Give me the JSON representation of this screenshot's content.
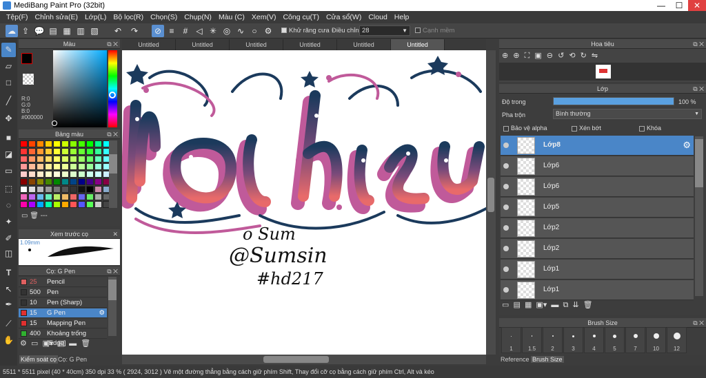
{
  "window": {
    "title": "MediBang Paint Pro (32bit)",
    "minimize": "—",
    "maximize": "☐",
    "close": "✕"
  },
  "menu": [
    "Tệp(F)",
    "Chỉnh sửa(E)",
    "Lớp(L)",
    "Bộ lọc(R)",
    "Chọn(S)",
    "Chụp(N)",
    "Màu (C)",
    "Xem(V)",
    "Công cụ(T)",
    "Cửa sổ(W)",
    "Cloud",
    "Help"
  ],
  "toolbar": {
    "antialias_label": "Khử răng cưa",
    "correction_label": "Điều chỉnh",
    "correction_value": "28",
    "sharp_label": "Cạnh mềm"
  },
  "tabs": [
    "Untitled",
    "Untitled",
    "Untitled",
    "Untitled",
    "Untitled",
    "Untitled"
  ],
  "color_panel": {
    "title": "Màu",
    "r": "R:0",
    "g": "G:0",
    "b": "B:0",
    "hex": "#000000"
  },
  "palette_panel": {
    "title": "Bảng màu",
    "footer": "---"
  },
  "brush_preview": {
    "title": "Xem trước cọ",
    "size": "1.09mm"
  },
  "brush_panel": {
    "title": "Cọ: G Pen",
    "brushes": [
      {
        "size": "25",
        "name": "Pencil",
        "color": "#e06060"
      },
      {
        "size": "500",
        "name": "Pen",
        "color": "#333333"
      },
      {
        "size": "10",
        "name": "Pen (Sharp)",
        "color": "#333333"
      },
      {
        "size": "15",
        "name": "G Pen",
        "color": "#e03030"
      },
      {
        "size": "15",
        "name": "Mapping Pen",
        "color": "#e03030"
      },
      {
        "size": "400",
        "name": "Khoảng trống [Edge]",
        "color": "#30b030"
      }
    ]
  },
  "bottom_tabs": [
    "Kiểm soát cọ",
    "Cọ: G Pen"
  ],
  "navigator": {
    "title": "Hoa tiêu"
  },
  "layer_panel": {
    "title": "Lớp",
    "opacity_label": "Độ trong",
    "opacity_value": "100 %",
    "opacity": 1.0,
    "blend_label": "Pha trộn",
    "blend_value": "Bình thường",
    "protect_alpha": "Bảo vệ alpha",
    "clipping": "Xén bớt",
    "lock": "Khóa",
    "layers": [
      "Lớp8",
      "Lớp6",
      "Lớp6",
      "Lớp5",
      "Lớp2",
      "Lớp2",
      "Lớp1",
      "Lớp1"
    ]
  },
  "brush_size_panel": {
    "title": "Brush Size",
    "sizes": [
      "1",
      "1.5",
      "2",
      "3",
      "4",
      "5",
      "7",
      "10",
      "12"
    ]
  },
  "right_bottom_tabs": [
    "Reference",
    "Brush Size"
  ],
  "canvas_text": {
    "line1": "o Sum",
    "line2": "@Sumsin",
    "line3": "#hd217"
  },
  "status": {
    "text": "5511 * 5511 pixel  (40 * 40cm)   350 dpi   33 %  ( 2924, 3012 )  Vẽ một đường thẳng bằng cách giữ phím Shift, Thay đổi cỡ cọ bằng cách giữ phím Ctrl, Alt và kéo"
  },
  "colors": {
    "accent": "#4a86c8",
    "panel": "#3d3d3d",
    "lettering_navy": "#1b3a5c",
    "lettering_coral": "#e86a6a",
    "lettering_pink": "#c05a9a"
  }
}
